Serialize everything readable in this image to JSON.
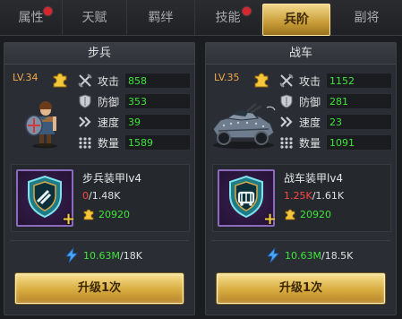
{
  "tabs": [
    {
      "label": "属性",
      "badge": true
    },
    {
      "label": "天赋",
      "badge": false
    },
    {
      "label": "羁绊",
      "badge": false
    },
    {
      "label": "技能",
      "badge": true
    },
    {
      "label": "兵阶",
      "badge": false,
      "active": true
    },
    {
      "label": "副将",
      "badge": false
    }
  ],
  "panels": [
    {
      "title": "步兵",
      "level": "LV.34",
      "stats": [
        {
          "label": "攻击",
          "value": "858"
        },
        {
          "label": "防御",
          "value": "353"
        },
        {
          "label": "速度",
          "value": "39"
        },
        {
          "label": "数量",
          "value": "1589"
        }
      ],
      "equip": {
        "name": "步兵装甲lv4",
        "current": "0",
        "total": "/1.48K",
        "gold": "20920"
      },
      "power": {
        "current": "10.63M",
        "total": "/18K"
      },
      "button": "升级1次"
    },
    {
      "title": "战车",
      "level": "LV.35",
      "stats": [
        {
          "label": "攻击",
          "value": "1152"
        },
        {
          "label": "防御",
          "value": "281"
        },
        {
          "label": "速度",
          "value": "23"
        },
        {
          "label": "数量",
          "value": "1091"
        }
      ],
      "equip": {
        "name": "战车装甲lv4",
        "current": "1.25K",
        "total": "/1.61K",
        "gold": "20920"
      },
      "power": {
        "current": "10.63M",
        "total": "/18.5K"
      },
      "button": "升级1次"
    }
  ],
  "colors": {
    "accent_gold": "#d7ab3f",
    "value_green": "#3ee53a",
    "warn_red": "#ff4646",
    "level_orange": "#f0a84a"
  }
}
